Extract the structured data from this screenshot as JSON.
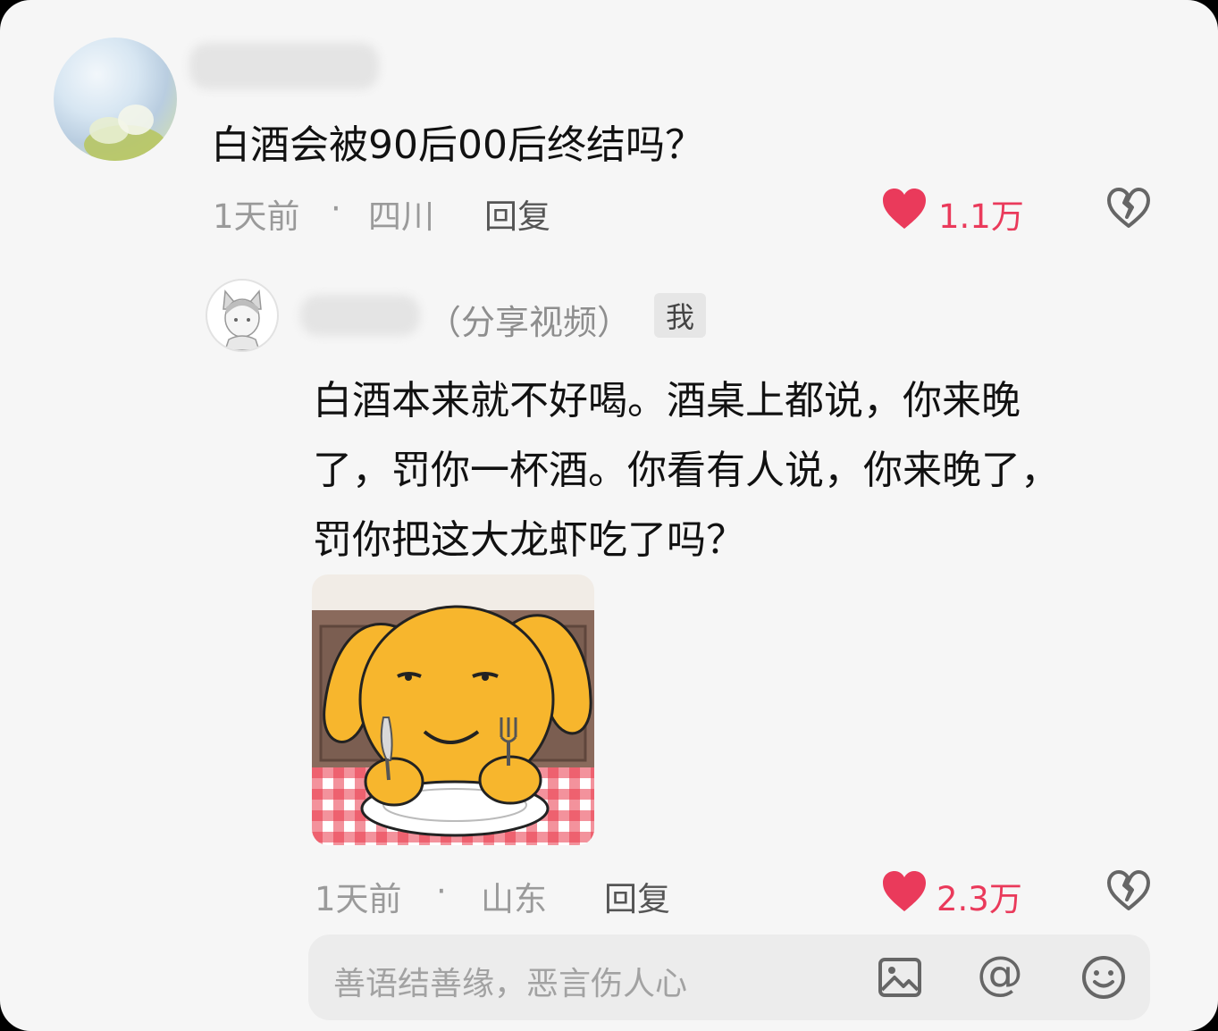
{
  "comment": {
    "text": "白酒会被90后00后终结吗？",
    "time": "1天前",
    "separator": "·",
    "location": "四川",
    "reply_label": "回复",
    "likes": "1.1万"
  },
  "reply": {
    "tag": "（分享视频）",
    "badge": "我",
    "text": "白酒本来就不好喝。酒桌上都说，你来晚了，罚你一杯酒。你看有人说，你来晚了，罚你把这大龙虾吃了吗？",
    "time": "1天前",
    "separator": "·",
    "location": "山东",
    "reply_label": "回复",
    "likes": "2.3万"
  },
  "input": {
    "placeholder": "善语结善缘，恶言伤人心",
    "at_symbol": "@"
  },
  "colors": {
    "like": "#ea3a5b",
    "background": "#f6f6f6"
  },
  "icons": [
    "heart-icon",
    "broken-heart-icon",
    "image-icon",
    "at-icon",
    "emoji-icon"
  ]
}
